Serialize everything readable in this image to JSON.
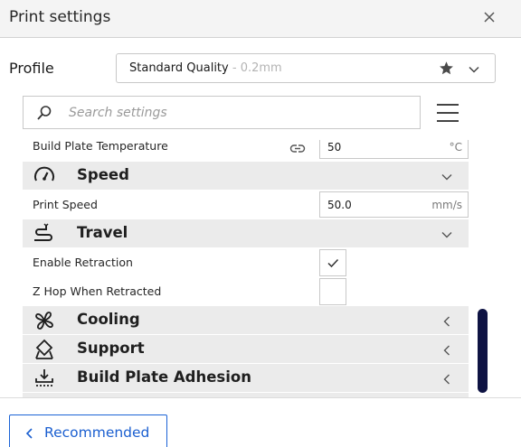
{
  "window": {
    "title": "Print settings",
    "close_icon": "close-icon"
  },
  "profile": {
    "label": "Profile",
    "selected_name": "Standard Quality",
    "selected_layer": " - 0.2mm",
    "icons": [
      "star-icon",
      "chevron-down-icon"
    ]
  },
  "search": {
    "placeholder": "Search settings",
    "value": "",
    "icon": "search-icon",
    "menu_icon": "hamburger-menu-icon"
  },
  "settings": {
    "build_plate_temp": {
      "label": "Build Plate Temperature",
      "value": "50",
      "unit": "°C",
      "link_icon": "link-icon"
    },
    "speed_category": {
      "label": "Speed",
      "icon": "speedometer-icon",
      "state": "expanded"
    },
    "print_speed": {
      "label": "Print Speed",
      "value": "50.0",
      "unit": "mm/s"
    },
    "travel_category": {
      "label": "Travel",
      "icon": "travel-path-icon",
      "state": "expanded"
    },
    "enable_retraction": {
      "label": "Enable Retraction",
      "checked": true
    },
    "z_hop": {
      "label": "Z Hop When Retracted",
      "checked": false
    },
    "cooling_category": {
      "label": "Cooling",
      "icon": "fan-icon",
      "state": "collapsed"
    },
    "support_category": {
      "label": "Support",
      "icon": "support-icon",
      "state": "collapsed"
    },
    "adhesion_category": {
      "label": "Build Plate Adhesion",
      "icon": "adhesion-icon",
      "state": "collapsed"
    }
  },
  "footer": {
    "recommended_label": "Recommended"
  },
  "colors": {
    "accent": "#1b63d6",
    "scrollbar": "#0e1343",
    "category_bg": "#ebebeb",
    "header_bg": "#f4f4f4"
  }
}
